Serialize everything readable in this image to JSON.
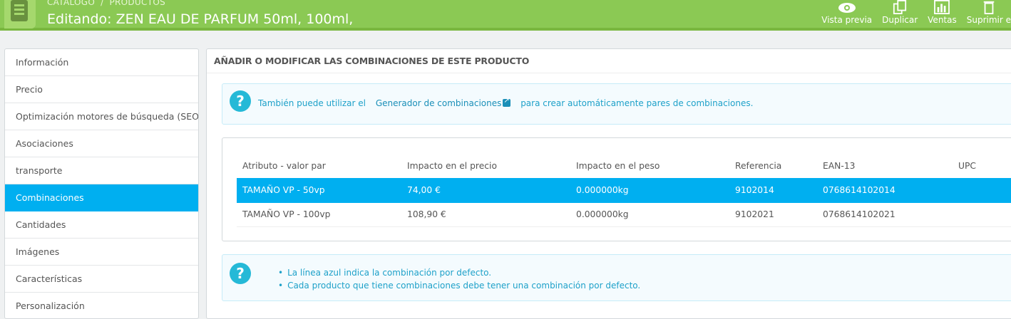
{
  "header": {
    "breadcrumb": [
      "CATÁLOGO",
      "PRODUCTOS"
    ],
    "title": "Editando: ZEN EAU DE PARFUM 50ml, 100ml,",
    "toolbar": [
      {
        "label": "Vista previa",
        "icon": "eye-icon"
      },
      {
        "label": "Duplicar",
        "icon": "copy-icon"
      },
      {
        "label": "Ventas",
        "icon": "bar-chart-icon"
      },
      {
        "label": "Suprimir e",
        "icon": "trash-icon"
      }
    ]
  },
  "sidebar": {
    "items": [
      {
        "label": "Información"
      },
      {
        "label": "Precio"
      },
      {
        "label": "Optimización motores de búsqueda (SEO)"
      },
      {
        "label": "Asociaciones"
      },
      {
        "label": "transporte"
      },
      {
        "label": "Combinaciones",
        "active": true
      },
      {
        "label": "Cantidades"
      },
      {
        "label": "Imágenes"
      },
      {
        "label": "Características"
      },
      {
        "label": "Personalización"
      }
    ]
  },
  "panel": {
    "heading": "Añadir o modificar las combinaciones de este producto",
    "info_top": {
      "before": "También puede utilizar el",
      "link": "Generador de combinaciones",
      "after": "para crear automáticamente pares de combinaciones."
    },
    "table": {
      "headers": [
        "Atributo - valor par",
        "Impacto en el precio",
        "Impacto en el peso",
        "Referencia",
        "EAN-13",
        "UPC"
      ],
      "rows": [
        {
          "attribute": "TAMAÑO VP - 50vp",
          "price": "74,00 €",
          "weight": "0.000000kg",
          "reference": "9102014",
          "ean13": "0768614102014",
          "upc": "",
          "default": true
        },
        {
          "attribute": "TAMAÑO VP - 100vp",
          "price": "108,90 €",
          "weight": "0.000000kg",
          "reference": "9102021",
          "ean13": "0768614102021",
          "upc": "",
          "default": false
        }
      ]
    },
    "info_bottom": {
      "bullets": [
        "La línea azul indica la combinación por defecto.",
        "Cada producto que tiene combinaciones debe tener una combinación por defecto."
      ]
    }
  },
  "colors": {
    "header_bg": "#8bc954",
    "accent": "#00aff0",
    "info_text": "#1ea1c9"
  }
}
